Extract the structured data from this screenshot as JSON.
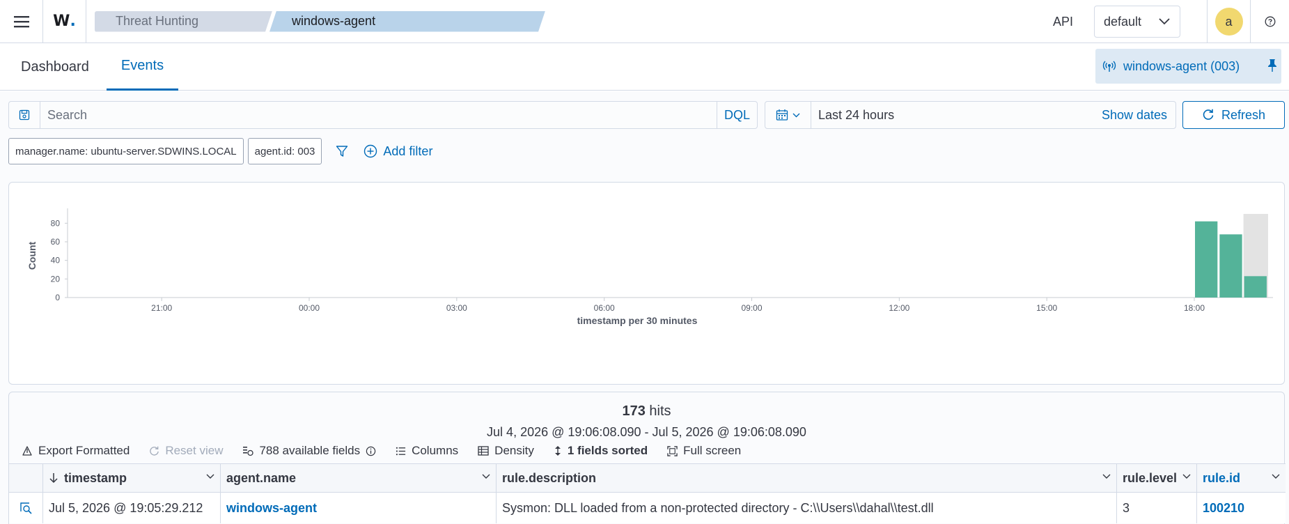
{
  "header": {
    "logo_text": "W",
    "breadcrumbs": [
      "Threat Hunting",
      "windows-agent"
    ],
    "api_label": "API",
    "tenant": "default",
    "avatar_letter": "a"
  },
  "tabs": [
    {
      "label": "Dashboard",
      "active": false
    },
    {
      "label": "Events",
      "active": true
    }
  ],
  "agent_pill": "windows-agent (003)",
  "query": {
    "placeholder": "Search",
    "language": "DQL",
    "time_range": "Last 24 hours",
    "show_dates": "Show dates",
    "refresh": "Refresh"
  },
  "filters": {
    "pills": [
      "manager.name: ubuntu-server.SDWINS.LOCAL",
      "agent.id: 003"
    ],
    "add_filter": "Add filter"
  },
  "chart_data": {
    "type": "bar",
    "xlabel": "timestamp per 30 minutes",
    "ylabel": "Count",
    "ylim": [
      0,
      90
    ],
    "yticks": [
      0,
      20,
      40,
      60,
      80
    ],
    "x_tick_labels": [
      "21:00",
      "00:00",
      "03:00",
      "06:00",
      "09:00",
      "12:00",
      "15:00",
      "18:00"
    ],
    "x_start_hour": 19.1,
    "x_end_hour": 43.1,
    "bars": [
      {
        "start_hour": 42.0,
        "value": 82
      },
      {
        "start_hour": 42.5,
        "value": 68
      },
      {
        "start_hour": 43.0,
        "value": 23
      }
    ],
    "highlight": {
      "start_hour": 43.0,
      "end_hour": 43.5,
      "color": "#e3e3e3"
    },
    "bar_color": "#54b399"
  },
  "results": {
    "hits_count": "173",
    "hits_label": " hits",
    "date_range": "Jul 4, 2026 @ 19:06:08.090 - Jul 5, 2026 @ 19:06:08.090",
    "toolbar": {
      "export": "Export Formatted",
      "reset": "Reset view",
      "fields": "788 available fields",
      "columns": "Columns",
      "density": "Density",
      "sorted": "1 fields sorted",
      "fullscreen": "Full screen"
    },
    "columns": [
      "timestamp",
      "agent.name",
      "rule.description",
      "rule.level",
      "rule.id"
    ],
    "rows": [
      {
        "timestamp": "Jul 5, 2026 @ 19:05:29.212",
        "agent_name": "windows-agent",
        "description": "Sysmon: DLL loaded from a non-protected directory - C:\\\\Users\\\\dahal\\\\test.dll",
        "level": "3",
        "rule_id": "100210"
      }
    ]
  },
  "colors": {
    "accent": "#006bb8",
    "border": "#d3dae6",
    "bar": "#54b399"
  }
}
